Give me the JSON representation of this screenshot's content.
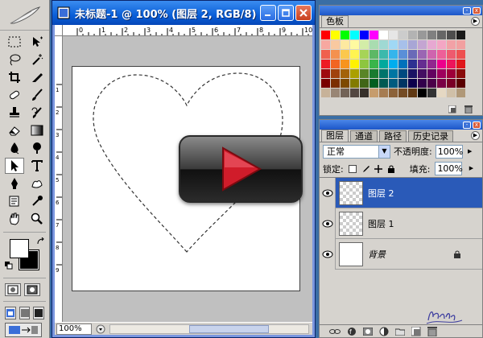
{
  "document": {
    "title": "未标题-1 @ 100% (图层 2, RGB/8)",
    "zoom": "100%",
    "ruler_top_labels": [
      "0",
      "1",
      "2",
      "3",
      "4",
      "5",
      "6",
      "7",
      "8",
      "9",
      "10"
    ],
    "ruler_left_labels": [
      "1",
      "2",
      "3",
      "4",
      "5",
      "6",
      "7",
      "8",
      "9"
    ]
  },
  "swatches_panel": {
    "tab": "色板",
    "colors": [
      "#ff0000",
      "#ffff00",
      "#00ff00",
      "#00ffff",
      "#0000ff",
      "#ff00ff",
      "#ffffff",
      "#e6e6e6",
      "#cccccc",
      "#b3b3b3",
      "#999999",
      "#808080",
      "#666666",
      "#4d4d4d",
      "#1a1a1a",
      "#f7a8a0",
      "#f9c9a0",
      "#fde9a0",
      "#fffaa0",
      "#d3eda8",
      "#a9dcb0",
      "#9fd9d3",
      "#a0d8f5",
      "#a7c0ea",
      "#a8a6d6",
      "#c4a5d2",
      "#e7a8d2",
      "#f4a6c4",
      "#f2a1a6",
      "#f2a0a0",
      "#f0604e",
      "#f4914f",
      "#fbc84d",
      "#fff450",
      "#a6d457",
      "#5db865",
      "#3cb9ac",
      "#35b5ec",
      "#5a8fd8",
      "#6a6ab8",
      "#9b66b3",
      "#cf64ae",
      "#ee5f98",
      "#ee5a6e",
      "#ee5050",
      "#ed1c24",
      "#f26522",
      "#f7941d",
      "#fff200",
      "#8dc63f",
      "#39b54a",
      "#00a99d",
      "#00aeef",
      "#0072bc",
      "#2e3192",
      "#662d91",
      "#92278f",
      "#ec008c",
      "#ed145b",
      "#e0161b",
      "#9e0b0f",
      "#a0410d",
      "#a36209",
      "#aba000",
      "#598527",
      "#197b30",
      "#00746b",
      "#0076a3",
      "#004a80",
      "#1b1464",
      "#440e62",
      "#630460",
      "#9e005d",
      "#9e0039",
      "#8a0b0b",
      "#790000",
      "#7b2e00",
      "#7d4900",
      "#827b00",
      "#406618",
      "#005e20",
      "#005952",
      "#005b7f",
      "#003663",
      "#0d004c",
      "#32004b",
      "#4b0049",
      "#7b0046",
      "#7a0026",
      "#5a0000",
      "#c7b299",
      "#998675",
      "#736357",
      "#534741",
      "#37302a",
      "#c69c6d",
      "#a67c52",
      "#8c6239",
      "#754c24",
      "#603913",
      "#000000",
      "#333333",
      "#e5d8c3",
      "#d0c0a8",
      "#b09878"
    ]
  },
  "layers_panel": {
    "tabs": [
      "图层",
      "通道",
      "路径",
      "历史记录"
    ],
    "blend_mode": "正常",
    "opacity_label": "不透明度:",
    "opacity_value": "100%",
    "lock_label": "锁定:",
    "fill_label": "填充:",
    "fill_value": "100%",
    "layers": [
      {
        "name": "图层 2",
        "selected": true
      },
      {
        "name": "图层 1",
        "selected": false
      },
      {
        "name": "背景",
        "selected": false
      }
    ]
  },
  "colors": {
    "title_bar": "#0a5fd8",
    "selected_layer": "#2a5ab8",
    "foreground": "#ffffff",
    "background": "#000000",
    "play_triangle": "#d01c2a"
  },
  "icons": [
    "feather-icon",
    "marquee-icon",
    "move-icon",
    "lasso-icon",
    "magic-wand-icon",
    "crop-icon",
    "slice-icon",
    "healing-icon",
    "brush-icon",
    "stamp-icon",
    "history-brush-icon",
    "eraser-icon",
    "gradient-icon",
    "blur-icon",
    "dodge-icon",
    "path-select-icon",
    "type-icon",
    "pen-icon",
    "shape-icon",
    "notes-icon",
    "eyedropper-icon",
    "hand-icon",
    "zoom-icon",
    "eye-icon",
    "lock-icon",
    "play-icon"
  ]
}
